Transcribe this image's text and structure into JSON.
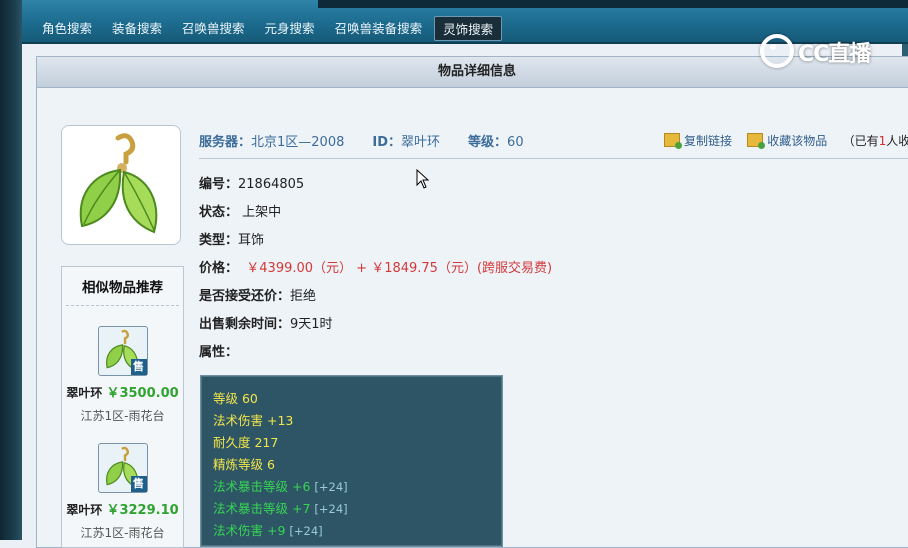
{
  "nav": {
    "tabs": [
      {
        "label": "角色搜索",
        "active": false
      },
      {
        "label": "装备搜索",
        "active": false
      },
      {
        "label": "召唤兽搜索",
        "active": false
      },
      {
        "label": "元身搜索",
        "active": false
      },
      {
        "label": "召唤兽装备搜索",
        "active": false
      },
      {
        "label": "灵饰搜索",
        "active": true
      }
    ]
  },
  "watermark": {
    "text": "CC直播"
  },
  "panel": {
    "title": "物品详细信息"
  },
  "item": {
    "server_label": "服务器：",
    "server": "北京1区—2008",
    "id_label": "ID：",
    "id": "翠叶环",
    "level_label": "等级：",
    "level": "60",
    "copy_link": "复制链接",
    "favorite": "收藏该物品",
    "fav_note_prefix": "（已有",
    "fav_count": "1",
    "fav_note_suffix": "人收藏",
    "number_label": "编号：",
    "number": "21864805",
    "status_label": "状态：",
    "status": "上架中",
    "type_label": "类型：",
    "type": "耳饰",
    "price_label": "价格：",
    "price": "￥4399.00（元） +  ￥1849.75（元）(跨服交易费)",
    "counter_label": "是否接受还价：",
    "counter": "拒绝",
    "time_label": "出售剩余时间：",
    "time": "9天1时",
    "attr_label": "属性："
  },
  "attributes": [
    {
      "text": "等级 60",
      "extra": "",
      "color": "yellow"
    },
    {
      "text": "法术伤害 +13",
      "extra": "",
      "color": "yellow"
    },
    {
      "text": "耐久度 217",
      "extra": "",
      "color": "yellow"
    },
    {
      "text": "精炼等级 6",
      "extra": "",
      "color": "yellow"
    },
    {
      "text": "法术暴击等级 +6 ",
      "extra": "[+24]",
      "color": "green"
    },
    {
      "text": "法术暴击等级 +7 ",
      "extra": "[+24]",
      "color": "green"
    },
    {
      "text": "法术伤害 +9 ",
      "extra": "[+24]",
      "color": "green"
    }
  ],
  "recommend": {
    "title": "相似物品推荐",
    "sell_badge": "售",
    "items": [
      {
        "name": "翠叶环",
        "price": "￥3500.00",
        "server": "江苏1区-雨花台"
      },
      {
        "name": "翠叶环",
        "price": "￥3229.10",
        "server": "江苏1区-雨花台"
      }
    ]
  },
  "colors": {
    "price": "#d23a3a",
    "rec_price": "#2fa32f",
    "attr_yellow": "#f2e64a",
    "attr_green": "#37d454"
  },
  "icons": {
    "copy": "copy-link-icon",
    "fav": "favorite-icon",
    "item": "leaf-earring-icon"
  }
}
